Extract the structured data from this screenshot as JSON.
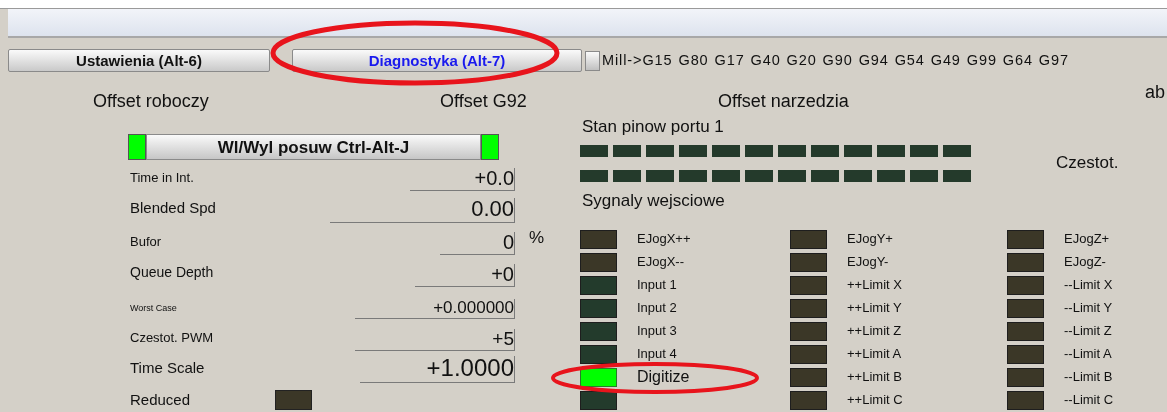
{
  "tabs": [
    {
      "label": "Ustawienia (Alt-6)",
      "selected": false
    },
    {
      "label": "Diagnostyka (Alt-7)",
      "selected": true
    }
  ],
  "gcode_status": "Mill->G15  G80 G17 G40 G20 G90 G94 G54 G49 G99 G64 G97",
  "headers": [
    "Offset roboczy",
    "Offset G92",
    "Offset narzedzia",
    "ab"
  ],
  "feed_toggle": {
    "label": "Wl/Wyl posuw Ctrl-Alt-J",
    "lamps": [
      {
        "on": true
      },
      {
        "on": true
      }
    ]
  },
  "readouts": [
    {
      "label": "Time in Int.",
      "value": "+0.0"
    },
    {
      "label": "Blended Spd",
      "value": "0.00"
    },
    {
      "label": "Bufor",
      "value": "0",
      "unit": "%"
    },
    {
      "label": "Queue Depth",
      "value": "+0"
    },
    {
      "label": "Worst Case",
      "value": "+0.000000"
    },
    {
      "label": "Czestot. PWM",
      "value": "+5"
    },
    {
      "label": "Time Scale",
      "value": "+1.0000"
    }
  ],
  "reduced": {
    "label": "Reduced",
    "on": false
  },
  "port_pins": {
    "title": "Stan pinow portu 1",
    "side_label": "Czestot.",
    "rows": [
      [
        {
          "on": false
        },
        {
          "on": false
        },
        {
          "on": false
        },
        {
          "on": false
        },
        {
          "on": false
        },
        {
          "on": false
        },
        {
          "on": false
        },
        {
          "on": false
        },
        {
          "on": false
        },
        {
          "on": false
        },
        {
          "on": false
        },
        {
          "on": false
        }
      ],
      [
        {
          "on": false
        },
        {
          "on": false
        },
        {
          "on": false
        },
        {
          "on": false
        },
        {
          "on": false
        },
        {
          "on": false
        },
        {
          "on": false
        },
        {
          "on": false
        },
        {
          "on": false
        },
        {
          "on": false
        },
        {
          "on": false
        },
        {
          "on": false
        }
      ]
    ]
  },
  "input_signals": {
    "title": "Sygnaly wejsciowe",
    "columns": [
      [
        {
          "label": "EJogX++",
          "on": false,
          "color": "#3b3727"
        },
        {
          "label": "EJogX--",
          "on": false,
          "color": "#3b3727"
        },
        {
          "label": "Input 1",
          "on": false,
          "color": "#233b2c"
        },
        {
          "label": "Input 2",
          "on": false,
          "color": "#233b2c"
        },
        {
          "label": "Input 3",
          "on": false,
          "color": "#233b2c"
        },
        {
          "label": "Input 4",
          "on": false,
          "color": "#233b2c"
        },
        {
          "label": "Digitize",
          "on": true,
          "color": "#00ff00"
        },
        {
          "on": false,
          "color": "#233b2c"
        }
      ],
      [
        {
          "label": "EJogY+",
          "on": false,
          "color": "#3b3727"
        },
        {
          "label": "EJogY-",
          "on": false,
          "color": "#3b3727"
        },
        {
          "label": "++Limit X",
          "on": false,
          "color": "#3b3727"
        },
        {
          "label": "++Limit Y",
          "on": false,
          "color": "#3b3727"
        },
        {
          "label": "++Limit Z",
          "on": false,
          "color": "#3b3727"
        },
        {
          "label": "++Limit A",
          "on": false,
          "color": "#3b3727"
        },
        {
          "label": "++Limit B",
          "on": false,
          "color": "#3b3727"
        },
        {
          "label": "++Limit C",
          "on": false,
          "color": "#3b3727"
        }
      ],
      [
        {
          "label": "EJogZ+",
          "on": false,
          "color": "#3b3727"
        },
        {
          "label": "EJogZ-",
          "on": false,
          "color": "#3b3727"
        },
        {
          "label": "--Limit X",
          "on": false,
          "color": "#3b3727"
        },
        {
          "label": "--Limit Y",
          "on": false,
          "color": "#3b3727"
        },
        {
          "label": "--Limit Z",
          "on": false,
          "color": "#3b3727"
        },
        {
          "label": "--Limit A",
          "on": false,
          "color": "#3b3727"
        },
        {
          "label": "--Limit B",
          "on": false,
          "color": "#3b3727"
        },
        {
          "label": "--Limit C",
          "on": false,
          "color": "#3b3727"
        }
      ]
    ]
  },
  "annotations": [
    {
      "kind": "ellipse"
    },
    {
      "kind": "ellipse"
    }
  ]
}
